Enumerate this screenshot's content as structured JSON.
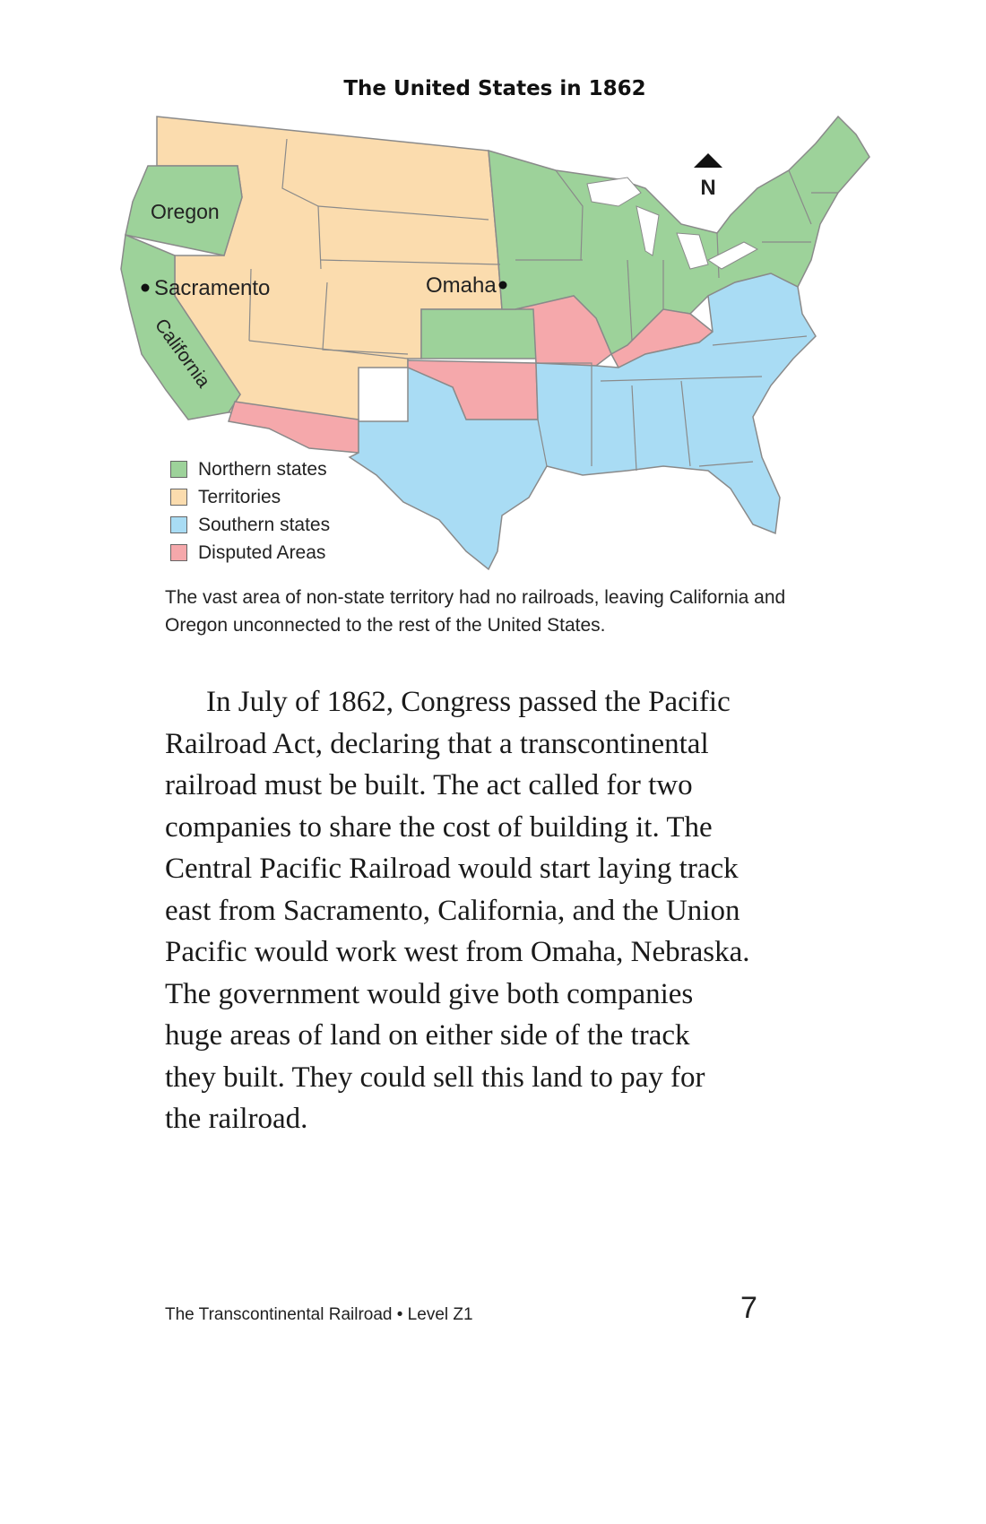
{
  "map": {
    "title": "The United States in 1862",
    "north_label": "N",
    "labels": {
      "oregon": "Oregon",
      "sacramento": "Sacramento",
      "california": "California",
      "omaha": "Omaha"
    },
    "colors": {
      "northern": "#9dd29a",
      "territories": "#fbdcae",
      "southern": "#a9dcf4",
      "disputed": "#f5a8ab",
      "border": "#8a8a8a"
    },
    "legend": [
      {
        "label": "Northern states",
        "color": "#9dd29a"
      },
      {
        "label": "Territories",
        "color": "#fbdcae"
      },
      {
        "label": "Southern states",
        "color": "#a9dcf4"
      },
      {
        "label": "Disputed Areas",
        "color": "#f5a8ab"
      }
    ]
  },
  "caption_lines": [
    "The vast area of non-state territory had no railroads, leaving California and",
    "Oregon unconnected to the rest of the United States."
  ],
  "body_lines": [
    "In July of 1862, Congress passed the Pacific",
    "Railroad Act, declaring that a transcontinental",
    "railroad must be built. The act called for two",
    "companies to share the cost of building it. The",
    "Central Pacific Railroad would start laying track",
    "east from Sacramento, California, and the Union",
    "Pacific would work west from Omaha, Nebraska.",
    "The government would give both companies",
    "huge areas of land on either side of the track",
    "they built. They could sell this land to pay for",
    "the railroad."
  ],
  "footer": {
    "book": "The Transcontinental Railroad • Level Z1",
    "page_number": "7"
  }
}
